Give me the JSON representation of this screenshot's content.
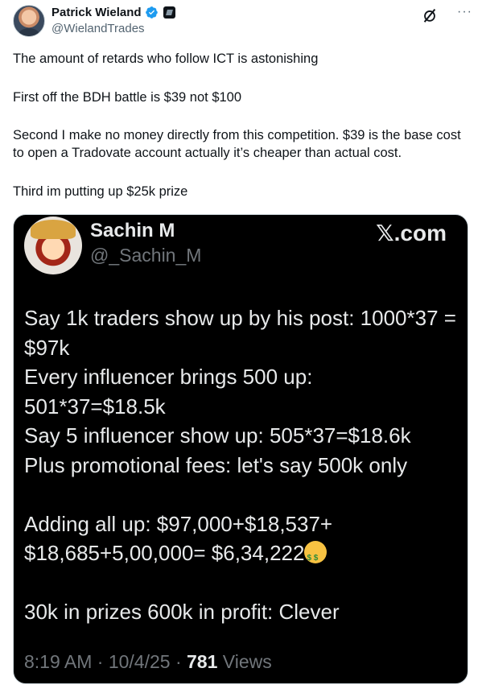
{
  "author": {
    "display_name": "Patrick Wieland",
    "handle": "@WielandTrades"
  },
  "icons": {
    "verified": "verified-badge-icon",
    "affiliate": "affiliate-badge-icon",
    "grok": "grok-icon",
    "more": "more-icon"
  },
  "more_label": "···",
  "tweet_paragraphs": [
    "The amount of retards who follow ICT is astonishing",
    "First off the BDH battle is $39 not $100",
    "Second I make no money directly from this competition. $39 is the base cost to open a Tradovate account actually it’s cheaper than actual cost.",
    "Third im putting up $25k prize"
  ],
  "media": {
    "name": "Sachin M",
    "handle": "@_Sachin_M",
    "brand": "𝕏.com",
    "lines": [
      "Say 1k traders show up by his post: 1000*37 = $97k",
      "Every influencer brings 500 up: 501*37=$18.5k",
      "Say 5 influencer show up: 505*37=$18.6k",
      "Plus promotional fees: let's say 500k only",
      "Adding all up: $97,000+$18,537+ $18,685+5,00,000= $6,34,222",
      "30k in prizes 600k in profit: Clever"
    ],
    "footer_time": "8:19 AM · 10/4/25 · ",
    "footer_views_count": "781",
    "footer_views_label": " Views",
    "emoji": "money-mouth-face"
  },
  "colors": {
    "verified_blue": "#1d9bf0",
    "text_primary": "#0f1419",
    "text_secondary": "#536471",
    "media_bg": "#000000"
  }
}
